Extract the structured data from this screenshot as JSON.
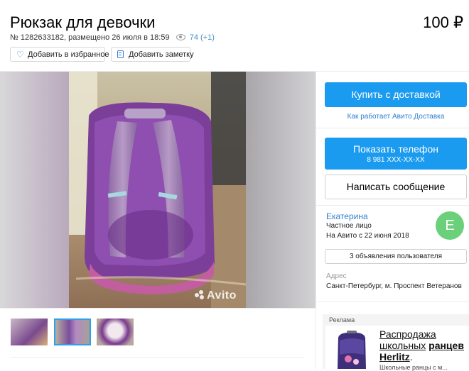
{
  "listing": {
    "title": "Рюкзак для девочки",
    "price": "100 ₽",
    "meta_prefix": "№ 1282633182, размещено 26 июля в 18:59",
    "views": "74 (+1)"
  },
  "actions": {
    "favorite_label": "Добавить в избранное",
    "note_label": "Добавить заметку"
  },
  "gallery": {
    "watermark": "Avito",
    "selected_thumb": 2,
    "thumb_count": 3
  },
  "sidebar": {
    "buy_label": "Купить с доставкой",
    "delivery_link": "Как работает Авито Доставка",
    "phone_label": "Показать телефон",
    "phone_masked": "8 981 XXX-XX-XX",
    "message_label": "Написать сообщение",
    "seller": {
      "name": "Екатерина",
      "type": "Частное лицо",
      "since": "На Авито с 22 июня 2018",
      "avatar_letter": "E"
    },
    "user_ads_label": "3 объявления пользователя",
    "address_label": "Адрес",
    "address_value": "Санкт-Петербург, м. Проспект Ветеранов"
  },
  "ad": {
    "label": "Реклама",
    "title_line1": "Распродажа",
    "title_line2_plain": "школьных",
    "title_line2_bold": "ранцев",
    "title_line3_bold": "Herlitz",
    "title_line3_end": ".",
    "subtitle": "Школьные ранцы с м..."
  },
  "colors": {
    "primary": "#1b9bf0",
    "link": "#2f7fd1",
    "avatar": "#6bd07a"
  }
}
